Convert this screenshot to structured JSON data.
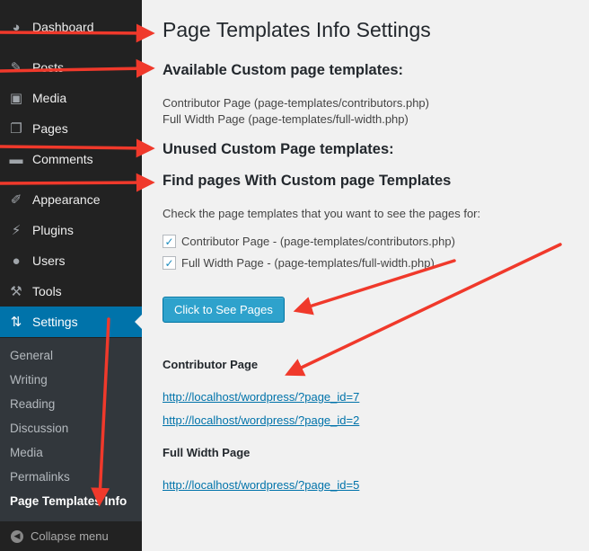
{
  "sidebar": {
    "items": [
      {
        "label": "Dashboard",
        "icon": "dashboard-icon",
        "glyph": "◕"
      },
      {
        "label": "Posts",
        "icon": "pin-icon",
        "glyph": "✎"
      },
      {
        "label": "Media",
        "icon": "media-icon",
        "glyph": "▣"
      },
      {
        "label": "Pages",
        "icon": "pages-icon",
        "glyph": "❐"
      },
      {
        "label": "Comments",
        "icon": "comment-icon",
        "glyph": "▬"
      },
      {
        "label": "Appearance",
        "icon": "brush-icon",
        "glyph": "✐"
      },
      {
        "label": "Plugins",
        "icon": "plugin-icon",
        "glyph": "⚡"
      },
      {
        "label": "Users",
        "icon": "user-icon",
        "glyph": "●"
      },
      {
        "label": "Tools",
        "icon": "wrench-icon",
        "glyph": "⚒"
      },
      {
        "label": "Settings",
        "icon": "settings-icon",
        "glyph": "⇅"
      }
    ],
    "submenu": [
      "General",
      "Writing",
      "Reading",
      "Discussion",
      "Media",
      "Permalinks",
      "Page Templates Info"
    ],
    "collapse_label": "Collapse menu"
  },
  "main": {
    "title": "Page Templates Info Settings",
    "available_heading": "Available Custom page templates:",
    "available_templates": [
      "Contributor Page (page-templates/contributors.php)",
      "Full Width Page (page-templates/full-width.php)"
    ],
    "unused_heading": "Unused Custom Page templates:",
    "find_heading": "Find pages With Custom page Templates",
    "instruction": "Check the page templates that you want to see the pages for:",
    "checkboxes": [
      {
        "label": "Contributor Page - (page-templates/contributors.php)",
        "checked": true
      },
      {
        "label": "Full Width Page - (page-templates/full-width.php)",
        "checked": true
      }
    ],
    "button_label": "Click to See Pages",
    "results": [
      {
        "heading": "Contributor Page",
        "links": [
          "http://localhost/wordpress/?page_id=7",
          "http://localhost/wordpress/?page_id=2"
        ]
      },
      {
        "heading": "Full Width Page",
        "links": [
          "http://localhost/wordpress/?page_id=5"
        ]
      }
    ]
  },
  "colors": {
    "sidebar_bg": "#222222",
    "active_menu": "#0073aa",
    "button": "#2ea2cc",
    "link": "#0073aa",
    "annotation_arrow": "#f0392b"
  }
}
